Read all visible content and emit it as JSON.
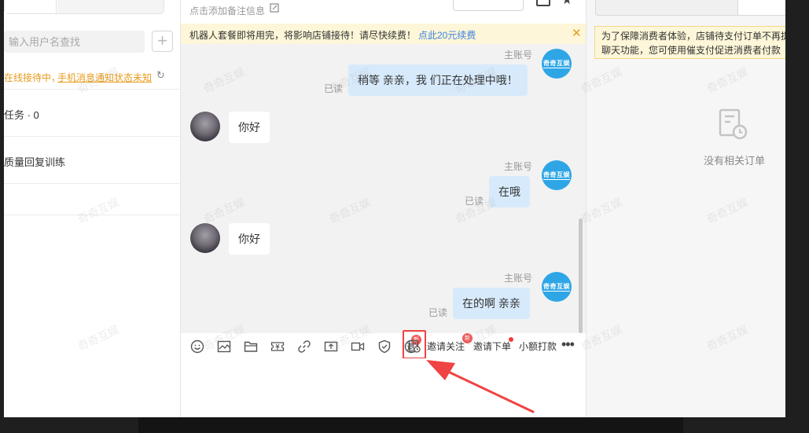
{
  "left": {
    "search_placeholder": "输入用户名查找",
    "add_label": "+",
    "status_prefix": "在线接待中，",
    "status_link": "手机消息通知状态未知",
    "refresh_icon": "↻",
    "task_label": "任务 · 0",
    "training_label": "质量回复训练"
  },
  "chat": {
    "remark_placeholder": "点击添加备注信息",
    "notice_text": "机器人套餐即将用完，将影响店铺接待！请尽快续费！",
    "notice_link": "点此20元续费",
    "notice_close": "✕",
    "messages": [
      {
        "type": "out",
        "sender": "主账号",
        "avatar_text": "奇奇互娱",
        "text": "稍等 亲亲，我 们正在处理中哦！",
        "read": "已读"
      },
      {
        "type": "in",
        "text": "你好"
      },
      {
        "type": "out",
        "sender": "主账号",
        "avatar_text": "奇奇互娱",
        "text": "在哦",
        "read": "已读"
      },
      {
        "type": "in",
        "text": "你好"
      },
      {
        "type": "out",
        "sender": "主账号",
        "avatar_text": "奇奇互娱",
        "text": "在的啊 亲亲",
        "read": "已读"
      }
    ],
    "toolbar": {
      "badge_new": "新",
      "refund_glyph": "退",
      "invite_follow": "邀请关注",
      "invite_order": "邀请下单",
      "small_pay": "小额打款",
      "more": "•••"
    }
  },
  "right": {
    "tip_line1": "为了保障消费者体验，店铺待支付订单不再提",
    "tip_line2": "聊天功能，您可使用催支付促进消费者付款",
    "empty_text": "没有相关订单"
  },
  "watermark": "奇奇互娱",
  "colors": {
    "accent": "#2ea6e6",
    "highlight": "#f04343",
    "notice_bg": "#fdf6d8",
    "bubble_out": "#d7eafb",
    "link": "#3b82e0",
    "warning": "#e89b1a"
  }
}
